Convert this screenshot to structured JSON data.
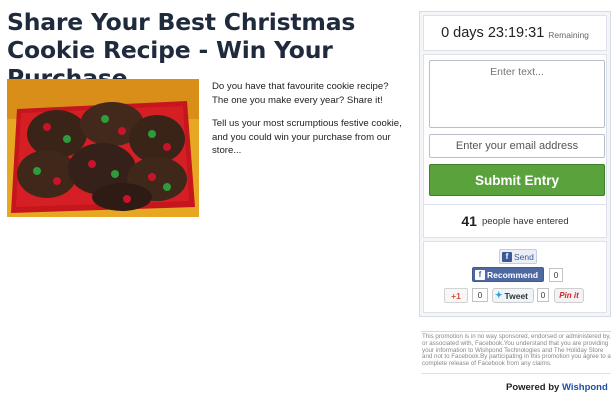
{
  "promo": {
    "title": "Share Your Best Christmas Cookie Recipe - Win Your Purchase",
    "description": [
      "Do you have that favourite cookie recipe? The one you make every year? Share it!",
      "Tell us your most scrumptious festive cookie, and you could win your purchase from our store..."
    ],
    "image_alt": "Plate of chocolate cookies with red and green candies"
  },
  "timer": {
    "value": "0 days 23:19:31",
    "label": "Remaining"
  },
  "form": {
    "text_placeholder": "Enter text...",
    "email_placeholder": "Enter your email address",
    "submit_label": "Submit Entry"
  },
  "entries": {
    "count": "41",
    "label": "people have entered"
  },
  "social": {
    "fb_send_label": "Send",
    "fb_recommend_label": "Recommend",
    "fb_recommend_count": "0",
    "gplus_label": "+1",
    "gplus_count": "0",
    "tweet_label": "Tweet",
    "tweet_count": "0",
    "pin_label": "Pin it"
  },
  "footer": {
    "disclaimer": "This promotion is in no way sponsored, endorsed or administered by, or associated with, Facebook.You understand that you are providing your information to Wishpond Technologies and The Holiday Store and not to Facebook.By participating in this promotion you agree to a complete release of Facebook from any claims.",
    "powered_by": "Powered by",
    "brand": "Wishpond"
  },
  "colors": {
    "submit_green": "#5aa23b",
    "facebook_blue": "#3b5998",
    "brand_blue": "#1f4fa3"
  }
}
